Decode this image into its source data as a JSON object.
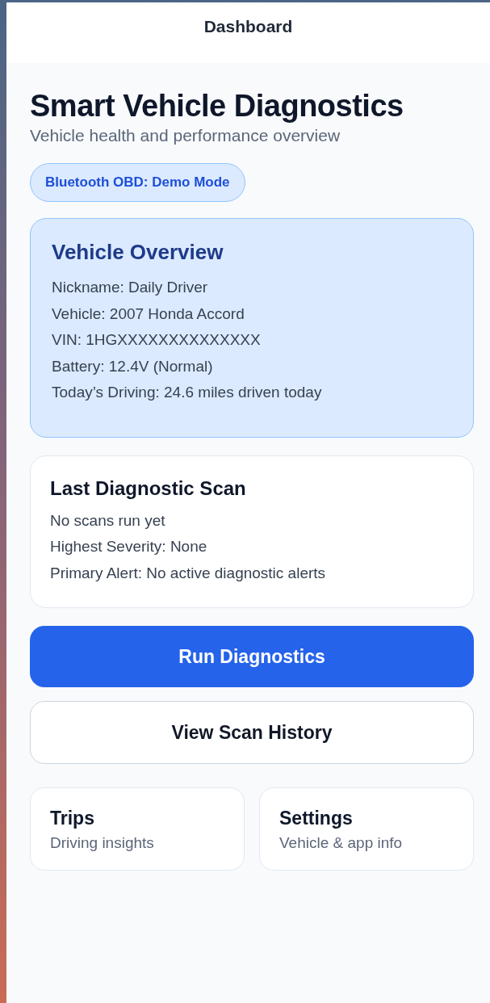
{
  "header": {
    "title": "Dashboard"
  },
  "page": {
    "title": "Smart Vehicle Diagnostics",
    "subtitle": "Vehicle health and performance overview"
  },
  "status_badge": "Bluetooth OBD: Demo Mode",
  "vehicle_overview": {
    "title": "Vehicle Overview",
    "lines": [
      "Nickname: Daily Driver",
      "Vehicle: 2007 Honda Accord",
      "VIN: 1HGXXXXXXXXXXXXXX",
      "Battery: 12.4V (Normal)",
      "Today’s Driving: 24.6 miles driven today"
    ]
  },
  "last_scan": {
    "title": "Last Diagnostic Scan",
    "lines": [
      "No scans run yet",
      "Highest Severity: None",
      "Primary Alert: No active diagnostic alerts"
    ]
  },
  "buttons": [
    {
      "label": "Run Diagnostics",
      "kind": "primary"
    },
    {
      "label": "View Scan History",
      "kind": "secondary"
    }
  ],
  "tiles": [
    {
      "title": "Trips",
      "subtitle": "Driving insights"
    },
    {
      "title": "Settings",
      "subtitle": "Vehicle & app info"
    }
  ]
}
